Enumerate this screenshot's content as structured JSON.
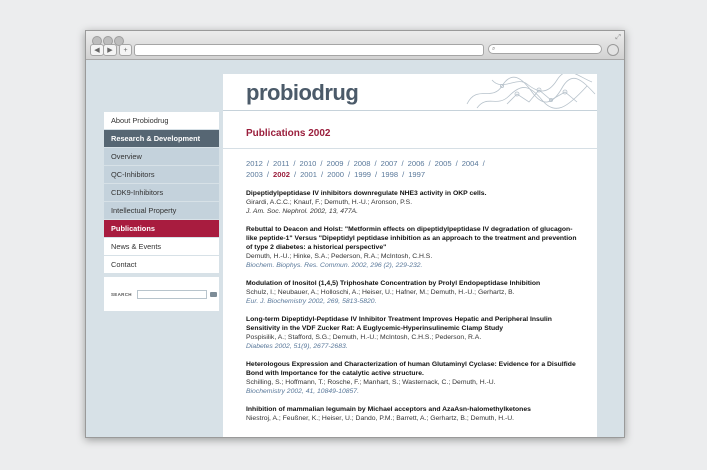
{
  "browser": {
    "back_icon": "back-arrow-icon",
    "forward_icon": "forward-arrow-icon",
    "add_tab_label": "+",
    "search_icon": "magnifier-icon"
  },
  "site": {
    "logo_text": "probiodrug"
  },
  "sidebar": {
    "items": [
      {
        "label": "About Probiodrug"
      },
      {
        "label": "Research & Development"
      },
      {
        "label": "Overview"
      },
      {
        "label": "QC-Inhibitors"
      },
      {
        "label": "CDK9-Inhibitors"
      },
      {
        "label": "Intellectual Property"
      },
      {
        "label": "Publications"
      },
      {
        "label": "News & Events"
      },
      {
        "label": "Contact"
      }
    ],
    "search_label": "SEARCH"
  },
  "main": {
    "title": "Publications 2002",
    "years_row1": [
      "2012",
      "2011",
      "2010",
      "2009",
      "2008",
      "2007",
      "2006",
      "2005",
      "2004"
    ],
    "years_row2": [
      "2003",
      "2002",
      "2001",
      "2000",
      "1999",
      "1998",
      "1997"
    ],
    "current_year": "2002",
    "publications": [
      {
        "title": "Dipeptidylpeptidase IV inhibitors downregulate NHE3 activity in OKP cells.",
        "authors": "Girardi, A.C.C.; Knauf, F.; Demuth, H.-U.; Aronson, P.S.",
        "journal": "J. Am. Soc. Nephrol. 2002, 13, 477A."
      },
      {
        "title": "Rebuttal to Deacon and Holst: \"Metformin effects on dipeptidylpeptidase IV degradation of glucagon-like peptide-1\" Versus \"Dipeptidyl peptidase inhibition as an approach to the treatment and prevention of type 2 diabetes: a historical perspective\"",
        "authors": "Demuth, H.-U.; Hinke, S.A.; Pederson, R.A.; McIntosh, C.H.S.",
        "journal": "Biochem. Biophys. Res. Commun. 2002, 296 (2), 229-232."
      },
      {
        "title": "Modulation of Inositol (1,4,5) Triphoshate Concentration by Prolyl Endopeptidase Inhibition",
        "authors": "Schulz, I.; Neubauer, A.; Holloschi, A.; Heiser, U.; Hafner, M.; Demuth, H.-U.; Gerhartz, B.",
        "journal": "Eur. J. Biochemistry 2002, 269, 5813-5820."
      },
      {
        "title": "Long-term Dipeptidyl-Peptidase IV Inhibitor Treatment Improves Hepatic and Peripheral Insulin Sensitivity in the VDF Zucker Rat: A Euglycemic-Hyperinsulinemic Clamp Study",
        "authors": "Pospisilik, A.; Stafford, S.G.; Demuth, H.-U.; McIntosh, C.H.S.; Pederson, R.A.",
        "journal": "Diabetes 2002, 51(9), 2677-2683."
      },
      {
        "title": "Heterologous Expression and Characterization of human Glutaminyl Cyclase: Evidence for a Disulfide Bond with Importance for the catalytic active structure.",
        "authors": "Schilling, S.; Hoffmann, T.; Rosche, F.; Manhart, S.; Wasternack, C.; Demuth, H.-U.",
        "journal": "Biochemistry 2002, 41, 10849-10857."
      },
      {
        "title": "Inhibition of mammalian legumain by Michael acceptors and AzaAsn-halomethylketones",
        "authors": "Niestroj, A.; Feußner, K.; Heiser, U.; Dando, P.M.; Barrett, A.; Gerhartz, B.; Demuth, H.-U.",
        "journal": ""
      }
    ]
  }
}
